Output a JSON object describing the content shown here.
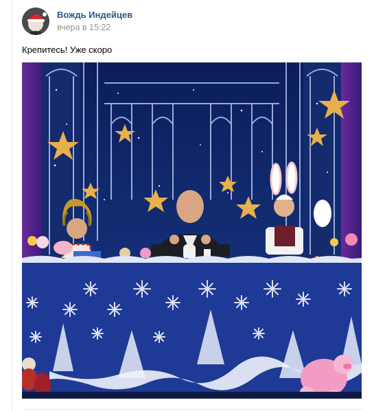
{
  "post": {
    "author": "Вождь Индейцев",
    "date": "вчера в 15:22",
    "text": "Крепитесь! Уже скоро"
  },
  "icons": {
    "avatar": "avatar-santa-hat",
    "photo": "tv-studio-new-year-photo"
  },
  "colors": {
    "link": "#2a5885",
    "muted": "#939393",
    "divider": "#e7e8ec"
  }
}
